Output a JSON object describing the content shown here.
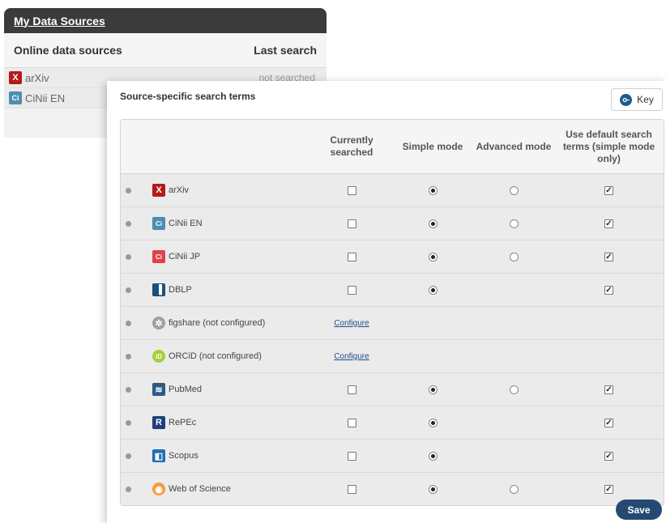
{
  "background_panel": {
    "title": "My Data Sources",
    "col_left": "Online data sources",
    "col_right": "Last search",
    "rows": [
      {
        "name": "arXiv",
        "status": "not searched"
      },
      {
        "name": "CiNii EN",
        "status": ""
      }
    ]
  },
  "modal": {
    "title": "Source-specific search terms",
    "key_label": "Key",
    "headers": {
      "currently": "Currently searched",
      "simple": "Simple mode",
      "advanced": "Advanced mode",
      "default": "Use default search terms (simple mode only)"
    },
    "configure_label": "Configure",
    "save_label": "Save"
  },
  "sources": [
    {
      "name": "arXiv",
      "icon": "arxiv-icon",
      "color": "#b31b1b",
      "glyph": "X",
      "configured": true,
      "searched": false,
      "simple": true,
      "has_advanced": true,
      "advanced": false,
      "default_terms": true
    },
    {
      "name": "CiNii EN",
      "icon": "cinii-en-icon",
      "color": "#4a8fb0",
      "glyph": "Ci",
      "configured": true,
      "searched": false,
      "simple": true,
      "has_advanced": true,
      "advanced": false,
      "default_terms": true
    },
    {
      "name": "CiNii JP",
      "icon": "cinii-jp-icon",
      "color": "#e0424a",
      "glyph": "Ci",
      "configured": true,
      "searched": false,
      "simple": true,
      "has_advanced": true,
      "advanced": false,
      "default_terms": true
    },
    {
      "name": "DBLP",
      "icon": "dblp-icon",
      "color": "#1a4f7a",
      "glyph": "▐",
      "configured": true,
      "searched": false,
      "simple": true,
      "has_advanced": false,
      "advanced": false,
      "default_terms": true
    },
    {
      "name": "figshare (not configured)",
      "icon": "figshare-icon",
      "color": "#9aa59a",
      "glyph": "✲",
      "configured": false
    },
    {
      "name": "ORCiD (not configured)",
      "icon": "orcid-icon",
      "color": "#a6ce39",
      "glyph": "iD",
      "configured": false
    },
    {
      "name": "PubMed",
      "icon": "pubmed-icon",
      "color": "#2b5a85",
      "glyph": "≋",
      "configured": true,
      "searched": false,
      "simple": true,
      "has_advanced": true,
      "advanced": false,
      "default_terms": true
    },
    {
      "name": "RePEc",
      "icon": "repec-icon",
      "color": "#1f3f7a",
      "glyph": "R",
      "configured": true,
      "searched": false,
      "simple": true,
      "has_advanced": false,
      "advanced": false,
      "default_terms": true
    },
    {
      "name": "Scopus",
      "icon": "scopus-icon",
      "color": "#1f6fb5",
      "glyph": "◧",
      "configured": true,
      "searched": false,
      "simple": true,
      "has_advanced": false,
      "advanced": false,
      "default_terms": true
    },
    {
      "name": "Web of Science",
      "icon": "web-of-science-icon",
      "color": "#f39b3c",
      "glyph": "◉",
      "configured": true,
      "searched": false,
      "simple": true,
      "has_advanced": true,
      "advanced": false,
      "default_terms": true
    }
  ]
}
